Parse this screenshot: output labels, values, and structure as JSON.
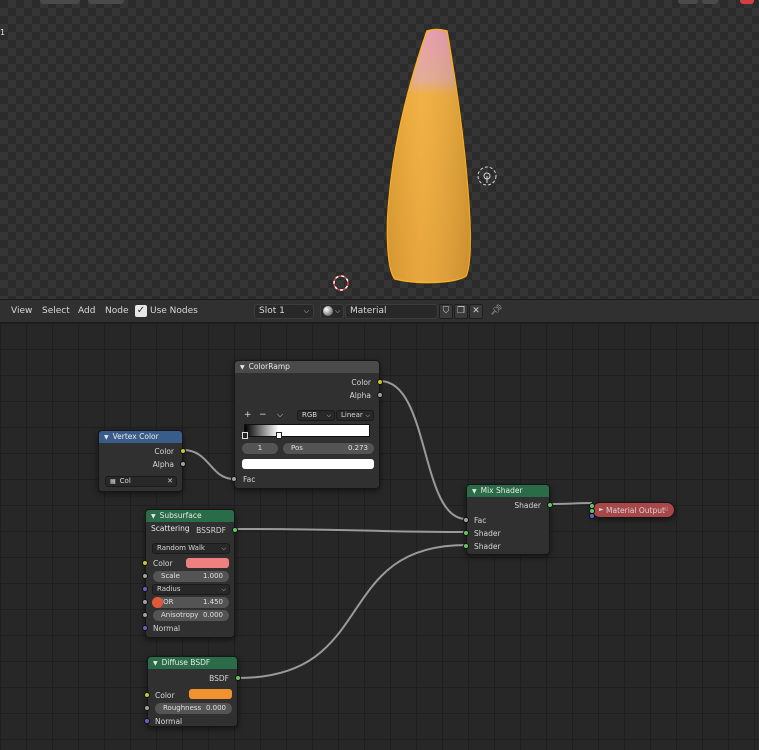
{
  "viewport": {
    "frame_label": "1",
    "object_colors": {
      "body": "#f0ad3a",
      "tip": "#e8a0b0",
      "outline": "#ffb020"
    }
  },
  "header": {
    "menus": [
      "View",
      "Select",
      "Add",
      "Node"
    ],
    "use_nodes_checked": true,
    "use_nodes_label": "Use Nodes",
    "slot": "Slot 1",
    "material": "Material"
  },
  "nodes": {
    "colorramp": {
      "title": "ColorRamp",
      "out_color": "Color",
      "out_alpha": "Alpha",
      "add": "+",
      "remove": "−",
      "menu": "⌵",
      "color_mode": "RGB",
      "interpolation": "Linear",
      "stop_index": "1",
      "pos_label": "Pos",
      "pos_value": "0.273",
      "in_fac": "Fac"
    },
    "vertex_color": {
      "title": "Vertex Color",
      "out_color": "Color",
      "out_alpha": "Alpha",
      "layer": "Col"
    },
    "sss": {
      "title": "Subsurface Scattering",
      "out_bssrdf": "BSSRDF",
      "method": "Random Walk",
      "color_label": "Color",
      "color": "#f08080",
      "scale_label": "Scale",
      "scale_value": "1.000",
      "radius": "Radius",
      "ior_label": "IOR",
      "ior_value": "1.450",
      "aniso_label": "Anisotropy",
      "aniso_value": "0.000",
      "normal": "Normal"
    },
    "diffuse": {
      "title": "Diffuse BSDF",
      "out_bsdf": "BSDF",
      "color_label": "Color",
      "color": "#f0922e",
      "rough_label": "Roughness",
      "rough_value": "0.000",
      "normal": "Normal"
    },
    "mix": {
      "title": "Mix Shader",
      "out_shader": "Shader",
      "in_fac": "Fac",
      "in_shader1": "Shader",
      "in_shader2": "Shader"
    },
    "output": {
      "title": "Material Output"
    }
  },
  "colors": {
    "link": "#9a9a9a",
    "accent_blue": "#3a5c8a",
    "shader_green": "#2a6b48",
    "output_red": "#a8474a"
  }
}
